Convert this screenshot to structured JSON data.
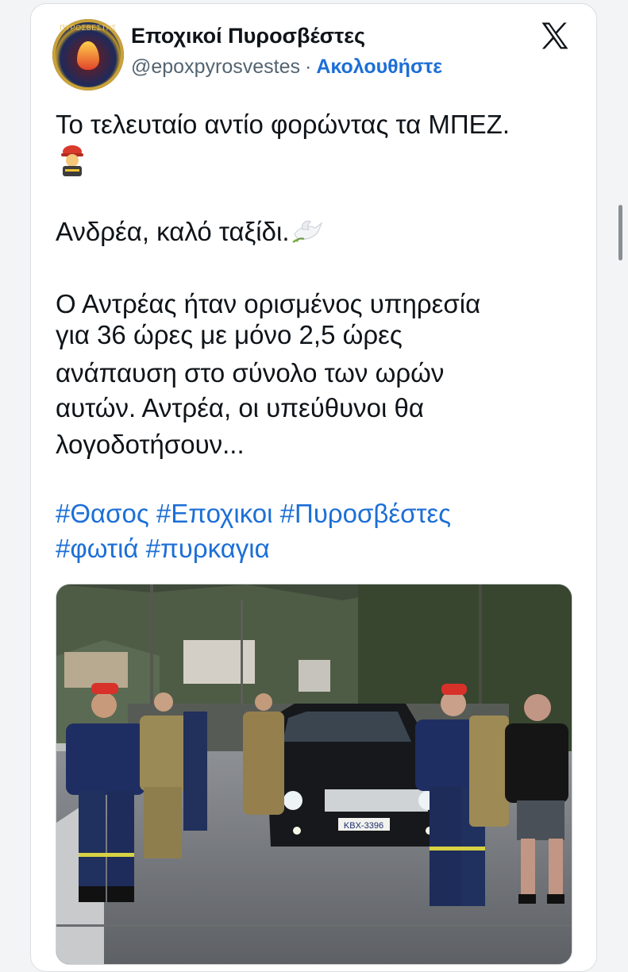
{
  "tweet": {
    "author_name": "Εποχικοί Πυροσβέστες",
    "handle": "@epoxpyrosvestes",
    "separator": "·",
    "follow_label": "Ακολουθήστε",
    "avatar_text": "ΠΥΡΟΣΒΕΣΤΗΣ",
    "line1": "Το τελευταίο αντίο φορώντας τα ΜΠΕΖ.",
    "line2": "Ανδρέα, καλό ταξίδι.",
    "para_lines": [
      "Ο Αντρέας ήταν ορισμένος υπηρεσία",
      "για 36 ώρες με μόνο 2,5 ώρες",
      "ανάπαυση στο σύνολο των ωρών",
      "αυτών. Αντρέα, οι υπεύθυνοι θα",
      "λογοδοτήσουν..."
    ],
    "hashtags": [
      "#Θασος",
      "#Εποχικοι",
      "#Πυροσβέστες",
      "#φωτιά",
      "#πυρκαγια"
    ],
    "emojis": [
      "firefighter-emoji",
      "dove-emoji"
    ]
  },
  "media": {
    "plate_text": "ΚΒΧ-3396"
  },
  "colors": {
    "link": "#1d6fd6",
    "text": "#0f1419",
    "secondary": "#536471"
  },
  "icons": [
    "x-logo-icon",
    "firefighter-emoji-icon",
    "dove-emoji-icon"
  ]
}
